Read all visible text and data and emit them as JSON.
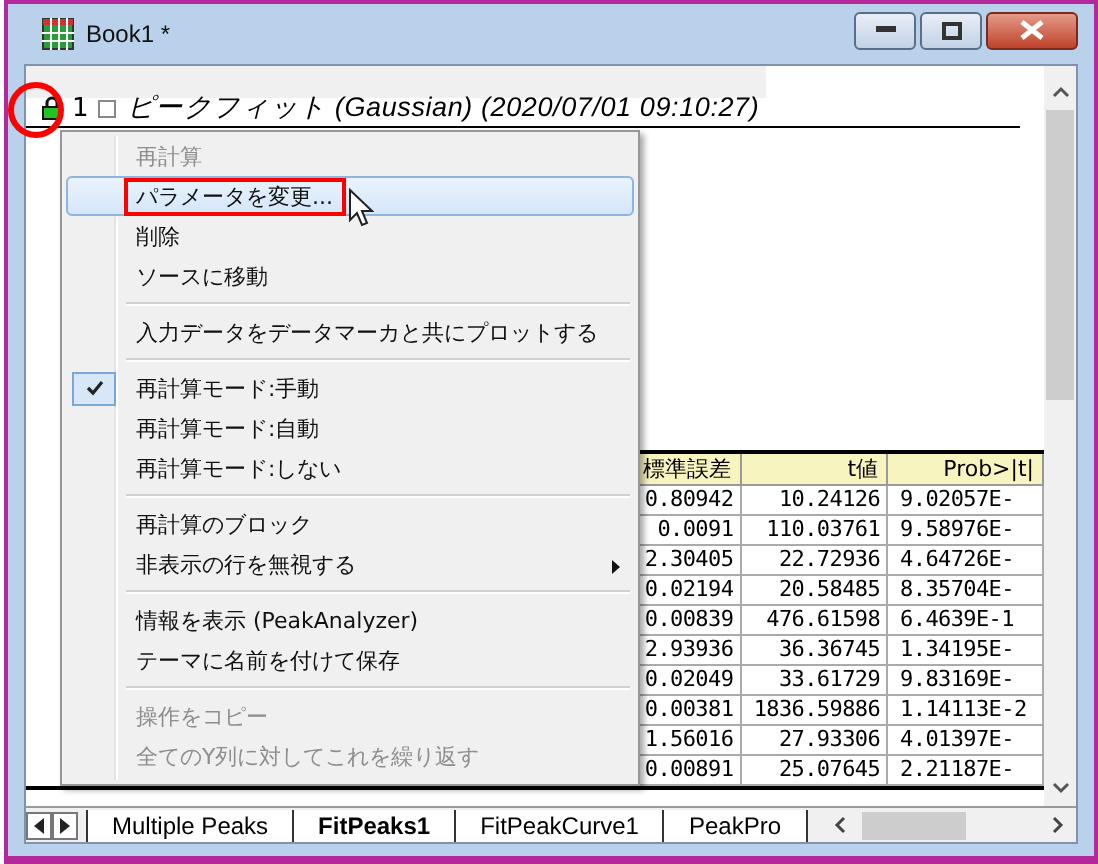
{
  "window": {
    "title": "Book1 *"
  },
  "tree_header": {
    "index": "1",
    "expanded": true,
    "locked": true,
    "title": "ピークフィット (Gaussian) (2020/07/01 09:10:27)"
  },
  "table": {
    "columns": [
      "標準誤差",
      "t値",
      "Prob>|t|"
    ],
    "rows": [
      [
        "0.80942",
        "10.24126",
        "9.02057E-"
      ],
      [
        "0.0091",
        "110.03761",
        "9.58976E-"
      ],
      [
        "2.30405",
        "22.72936",
        "4.64726E-"
      ],
      [
        "0.02194",
        "20.58485",
        "8.35704E-"
      ],
      [
        "0.00839",
        "476.61598",
        "6.4639E-1"
      ],
      [
        "2.93936",
        "36.36745",
        "1.34195E-"
      ],
      [
        "0.02049",
        "33.61729",
        "9.83169E-"
      ],
      [
        "0.00381",
        "1836.59886",
        "1.14113E-2"
      ],
      [
        "1.56016",
        "27.93306",
        "4.01397E-"
      ],
      [
        "0.00891",
        "25.07645",
        "2.21187E-"
      ]
    ]
  },
  "context_menu": {
    "items": [
      {
        "kind": "item",
        "label": "再計算",
        "disabled": true,
        "selected": false,
        "checked": false,
        "submenu": false
      },
      {
        "kind": "item",
        "label": "パラメータを変更...",
        "disabled": false,
        "selected": true,
        "checked": false,
        "submenu": false
      },
      {
        "kind": "item",
        "label": "削除",
        "disabled": false,
        "selected": false,
        "checked": false,
        "submenu": false
      },
      {
        "kind": "item",
        "label": "ソースに移動",
        "disabled": false,
        "selected": false,
        "checked": false,
        "submenu": false
      },
      {
        "kind": "separator"
      },
      {
        "kind": "item",
        "label": "入力データをデータマーカと共にプロットする",
        "disabled": false,
        "selected": false,
        "checked": false,
        "submenu": false
      },
      {
        "kind": "separator"
      },
      {
        "kind": "item",
        "label": "再計算モード:手動",
        "disabled": false,
        "selected": false,
        "checked": true,
        "submenu": false
      },
      {
        "kind": "item",
        "label": "再計算モード:自動",
        "disabled": false,
        "selected": false,
        "checked": false,
        "submenu": false
      },
      {
        "kind": "item",
        "label": "再計算モード:しない",
        "disabled": false,
        "selected": false,
        "checked": false,
        "submenu": false
      },
      {
        "kind": "separator"
      },
      {
        "kind": "item",
        "label": "再計算のブロック",
        "disabled": false,
        "selected": false,
        "checked": false,
        "submenu": false
      },
      {
        "kind": "item",
        "label": "非表示の行を無視する",
        "disabled": false,
        "selected": false,
        "checked": false,
        "submenu": true
      },
      {
        "kind": "separator"
      },
      {
        "kind": "item",
        "label": "情報を表示 (PeakAnalyzer)",
        "disabled": false,
        "selected": false,
        "checked": false,
        "submenu": false
      },
      {
        "kind": "item",
        "label": "テーマに名前を付けて保存",
        "disabled": false,
        "selected": false,
        "checked": false,
        "submenu": false
      },
      {
        "kind": "separator"
      },
      {
        "kind": "item",
        "label": "操作をコピー",
        "disabled": true,
        "selected": false,
        "checked": false,
        "submenu": false
      },
      {
        "kind": "item",
        "label": "全てのY列に対してこれを繰り返す",
        "disabled": true,
        "selected": false,
        "checked": false,
        "submenu": false
      }
    ]
  },
  "sheet_tabs": [
    {
      "label": "Multiple Peaks",
      "selected": false
    },
    {
      "label": "FitPeaks1",
      "selected": true
    },
    {
      "label": "FitPeakCurve1",
      "selected": false
    },
    {
      "label": "PeakPro",
      "selected": false
    }
  ]
}
